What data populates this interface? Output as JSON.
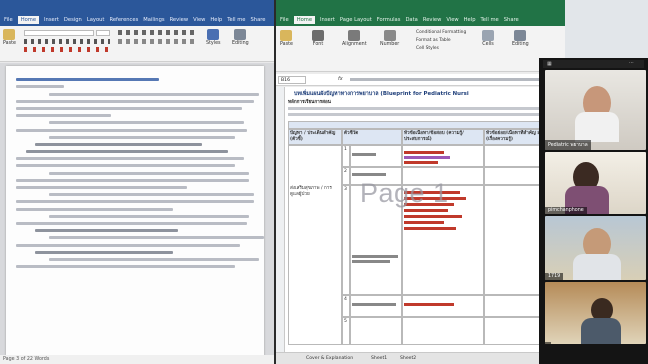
{
  "word": {
    "tabs": [
      "File",
      "Home",
      "Insert",
      "Design",
      "Layout",
      "References",
      "Mailings",
      "Review",
      "View",
      "Help",
      "Tell me",
      "Share"
    ],
    "active_tab": "Home",
    "ribbon": {
      "paste_label": "Paste",
      "styles_label": "Styles",
      "editing_label": "Editing"
    },
    "status": "Page 3 of 22   Words"
  },
  "excel": {
    "tabs": [
      "File",
      "Home",
      "Insert",
      "Page Layout",
      "Formulas",
      "Data",
      "Review",
      "View",
      "Help",
      "Tell me",
      "Share"
    ],
    "active_tab": "Home",
    "ribbon": {
      "paste_label": "Paste",
      "font_label": "Font",
      "alignment_label": "Alignment",
      "number_label": "Number",
      "conditional_label": "Conditional Formatting",
      "format_table_label": "Format as Table",
      "cell_styles_label": "Cell Styles",
      "cells_label": "Cells",
      "editing_label": "Editing"
    },
    "name_box": "B16",
    "fx": "fx",
    "sheet": {
      "title": "บทเพิ่มแผนผังปัญหาทางการพยาบาล (Blueprint for Pediatric Nursi",
      "subtitle": "หลักการเรียนการสอน",
      "col_headers": [
        "ปัญหา / ประเด็นสำคัญ (ตัวชี้)",
        "ตัวชี้วัด",
        "หัวข้อเนื้อหา/ข้อสอบ (ความรู้/ประสบการณ์)",
        "หัวข้อย่อย/เนื้อหาที่สำคัญ สำหรับ (เรื่องความรู้)"
      ],
      "section_label": "ส่งเสริมสุขภาพ / การดูแลผู้ป่วย",
      "rows": [
        "1",
        "2",
        "3",
        "4",
        "5"
      ]
    },
    "sheet_tabs": [
      "Cover & Explanation",
      "Sheet1",
      "Sheet2"
    ],
    "watermark": "Page 1"
  },
  "meeting": {
    "participants": [
      {
        "name": "Pediatric พยาบาล"
      },
      {
        "name": "pimchanphone"
      },
      {
        "name": "1719"
      },
      {
        "name": ""
      }
    ]
  }
}
